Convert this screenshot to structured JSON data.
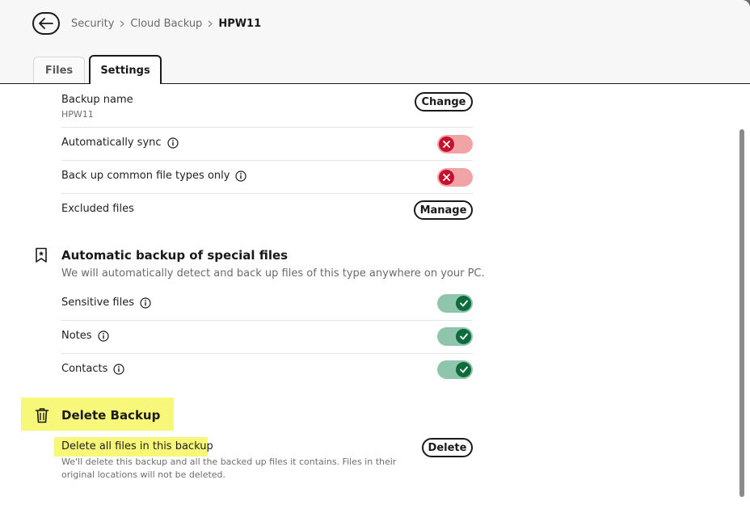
{
  "breadcrumb": {
    "items": [
      "Security",
      "Cloud Backup"
    ],
    "current": "HPW11"
  },
  "tabs": {
    "files": "Files",
    "settings": "Settings",
    "active": "Settings"
  },
  "settings": {
    "backup_name": {
      "label": "Backup name",
      "value": "HPW11",
      "button": "Change"
    },
    "auto_sync": {
      "label": "Automatically sync",
      "state": "off"
    },
    "common_types": {
      "label": "Back up common file types only",
      "state": "off"
    },
    "excluded": {
      "label": "Excluded files",
      "button": "Manage"
    }
  },
  "special": {
    "title": "Automatic backup of special files",
    "description": "We will automatically detect and back up files of this type anywhere on your PC.",
    "items": [
      {
        "label": "Sensitive files",
        "state": "on"
      },
      {
        "label": "Notes",
        "state": "on"
      },
      {
        "label": "Contacts",
        "state": "on"
      }
    ]
  },
  "delete": {
    "title": "Delete Backup",
    "row_label": "Delete all files in this backup",
    "description": "We'll delete this backup and all the backed up files it contains. Files in their original locations will not be deleted.",
    "button": "Delete"
  },
  "colors": {
    "toggle_off_track": "#f0a4a6",
    "toggle_off_knob": "#c8102e",
    "toggle_on_track": "#8fc5ac",
    "toggle_on_knob": "#0d6b3c",
    "highlight": "#f7f77a"
  },
  "icons": {
    "back": "arrow-left-icon",
    "info": "info-icon",
    "special": "bookmark-star-icon",
    "delete": "trash-icon"
  }
}
